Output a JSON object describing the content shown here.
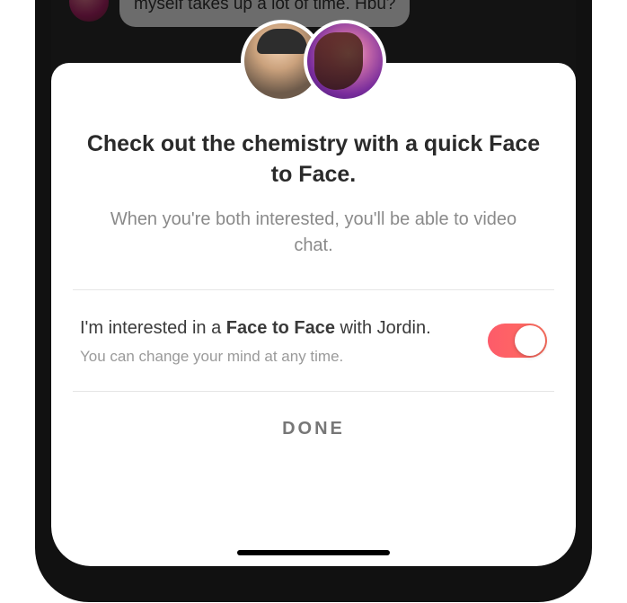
{
  "background": {
    "chat_snippet": "myself takes up a lot of time. Hbu?"
  },
  "sheet": {
    "title": "Check out the chemistry with a quick Face to Face.",
    "subtitle": "When you're both interested, you'll be able to video chat.",
    "toggle": {
      "label_prefix": "I'm interested in a ",
      "label_bold": "Face to Face",
      "label_suffix": " with Jordin.",
      "hint": "You can change your mind at any time.",
      "enabled": true
    },
    "done_label": "DONE"
  },
  "avatars": {
    "left": "user-avatar",
    "right": "match-avatar-jordin"
  },
  "colors": {
    "accent_start": "#fd5b6a",
    "accent_end": "#ff6f5e"
  }
}
